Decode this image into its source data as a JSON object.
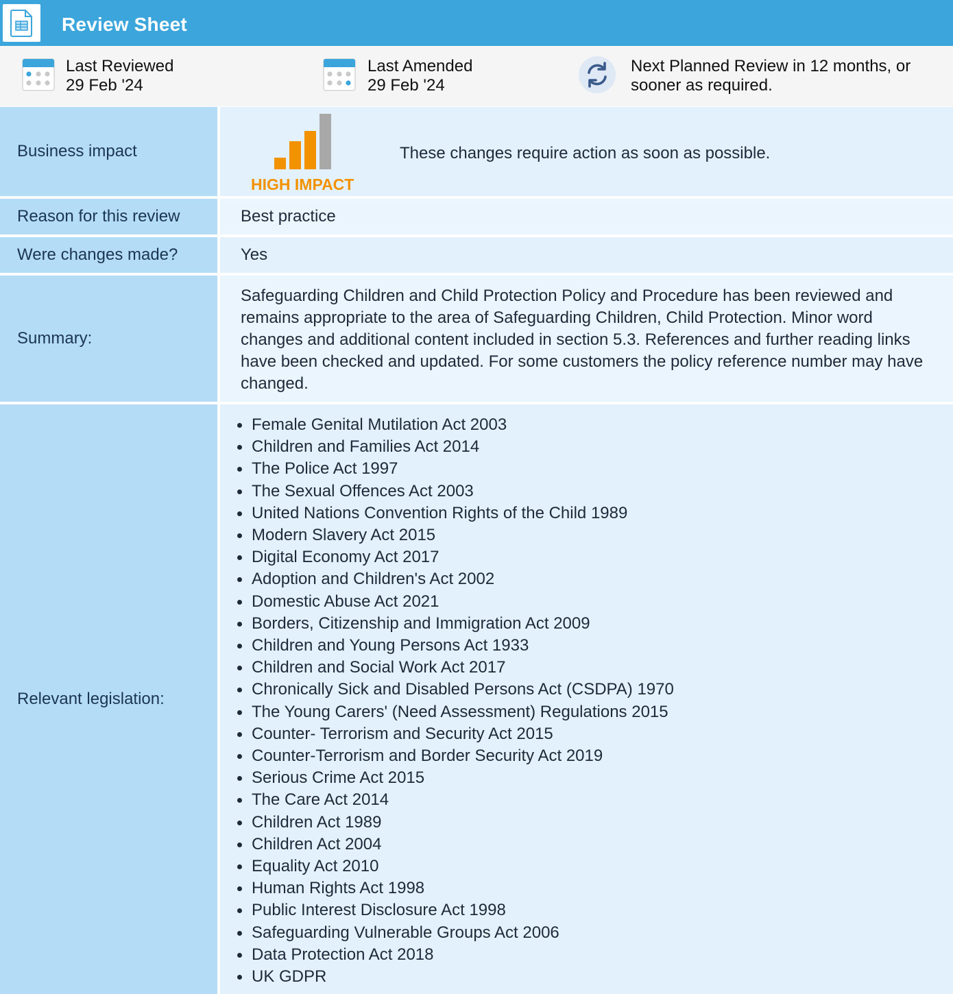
{
  "header": {
    "title": "Review Sheet",
    "icon": "document-sheet-icon",
    "color": "#3ba5dc"
  },
  "meta": {
    "last_reviewed": {
      "label": "Last Reviewed",
      "value": "29 Feb '24",
      "icon": "calendar-icon"
    },
    "last_amended": {
      "label": "Last Amended",
      "value": "29 Feb '24",
      "icon": "calendar-icon"
    },
    "next_review": {
      "line1": "Next Planned Review in 12 months, or",
      "line2": "sooner as required.",
      "icon": "refresh-icon"
    }
  },
  "rows": {
    "business_impact": {
      "label": "Business impact",
      "impact_label": "HIGH IMPACT",
      "impact_level": "high",
      "impact_color": "#f39200",
      "text": "These changes require action as soon as possible."
    },
    "reason": {
      "label": "Reason for this review",
      "value": "Best practice"
    },
    "changes": {
      "label": "Were changes made?",
      "value": "Yes"
    },
    "summary": {
      "label": "Summary:",
      "text": "Safeguarding Children and Child Protection Policy and Procedure has been reviewed and remains appropriate to the area of Safeguarding Children, Child Protection. Minor word changes and additional content included in section 5.3. References and further reading links have been checked and updated. For some customers the policy reference number may have changed."
    },
    "legislation": {
      "label": "Relevant legislation:",
      "items": [
        "Female Genital Mutilation Act 2003",
        "Children and Families Act 2014",
        "The Police Act 1997",
        "The Sexual Offences Act 2003",
        "United Nations Convention Rights of the Child 1989",
        "Modern Slavery Act 2015",
        "Digital Economy Act 2017",
        "Adoption and Children's Act 2002",
        "Domestic Abuse Act 2021",
        "Borders, Citizenship and Immigration Act 2009",
        "Children and Young Persons Act 1933",
        "Children and Social Work Act 2017",
        "Chronically Sick and Disabled Persons Act (CSDPA) 1970",
        "The Young Carers' (Need Assessment) Regulations 2015",
        "Counter- Terrorism and Security Act 2015",
        "Counter-Terrorism and Border Security Act 2019",
        "Serious Crime Act 2015",
        "The Care Act 2014",
        "Children Act 1989",
        "Children Act 2004",
        "Equality Act 2010",
        "Human Rights Act 1998",
        "Public Interest Disclosure Act 1998",
        "Safeguarding Vulnerable Groups Act 2006",
        "Data Protection Act 2018",
        "UK GDPR"
      ]
    }
  }
}
